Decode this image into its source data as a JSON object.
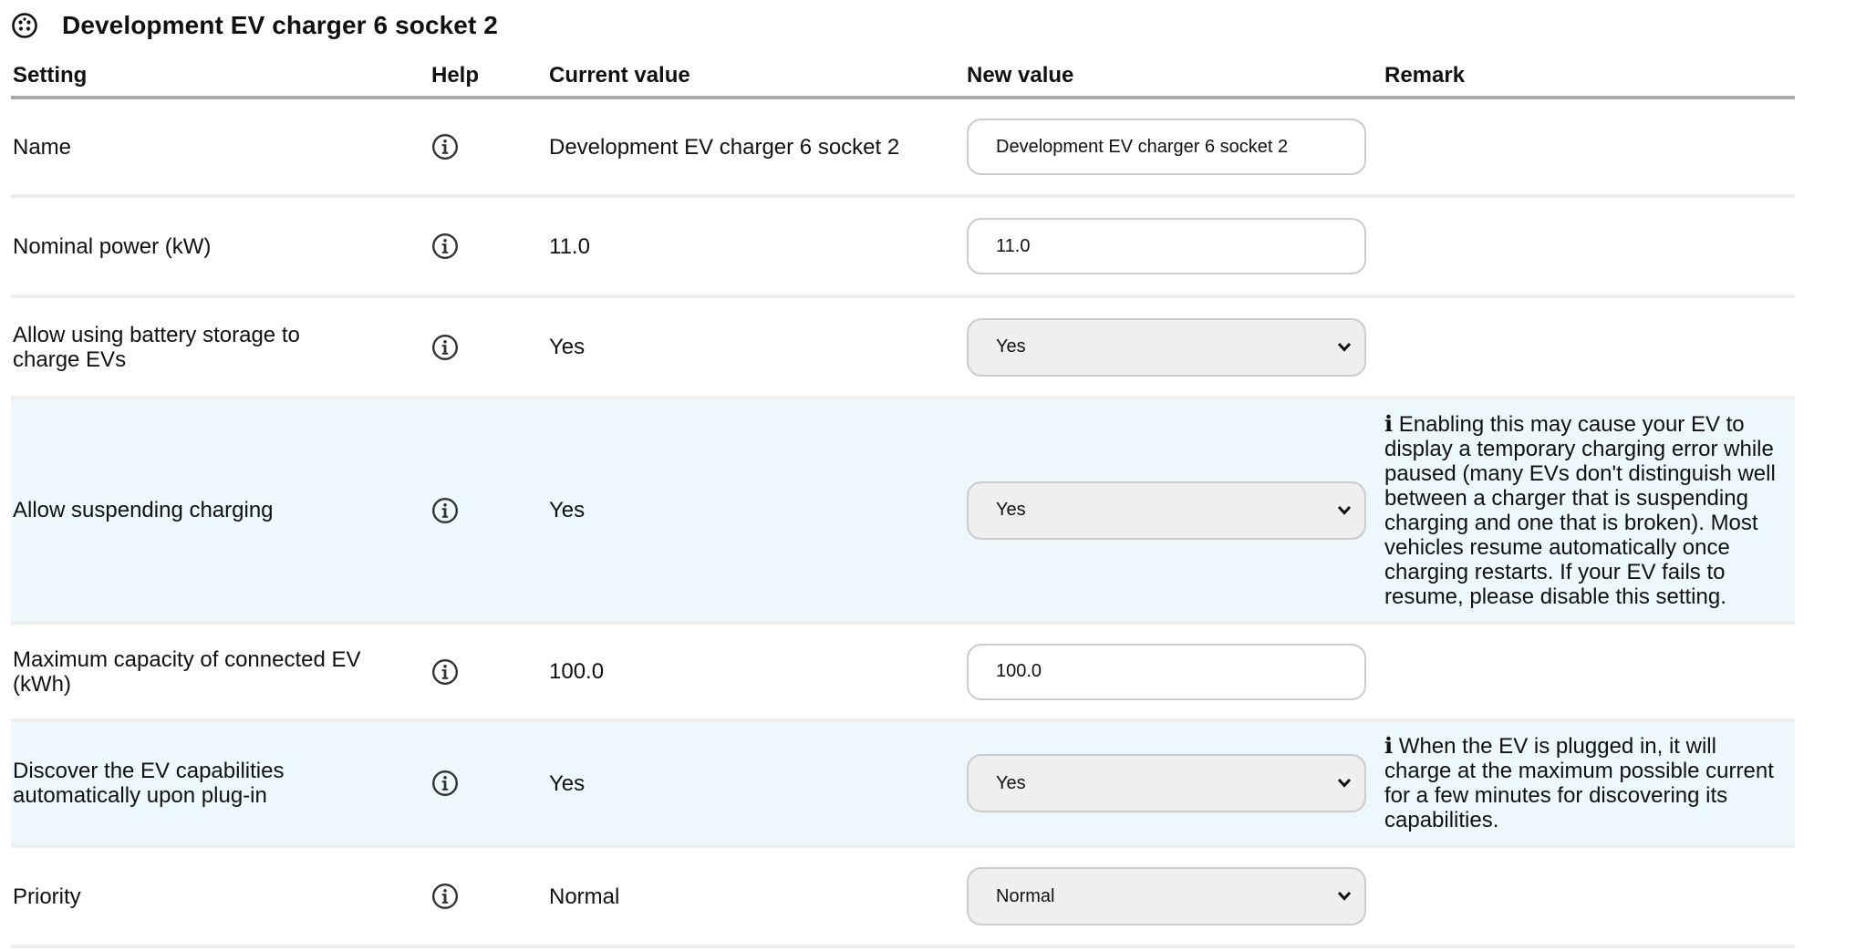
{
  "page": {
    "title": "Development EV charger 6 socket 2",
    "title_icon": "ev-plug-socket-icon"
  },
  "table": {
    "headers": {
      "setting": "Setting",
      "help": "Help",
      "current": "Current value",
      "new": "New value",
      "remark": "Remark"
    },
    "rows": [
      {
        "setting": "Name",
        "current": "Development EV charger 6 socket 2",
        "new_type": "text",
        "new_value": "Development EV charger 6 socket 2",
        "remark": ""
      },
      {
        "setting": "Nominal power (kW)",
        "current": "11.0",
        "new_type": "text",
        "new_value": "11.0",
        "remark": ""
      },
      {
        "setting": "Allow using battery storage to charge EVs",
        "current": "Yes",
        "new_type": "select",
        "new_value": "Yes",
        "remark": ""
      },
      {
        "setting": "Allow suspending charging",
        "current": "Yes",
        "new_type": "select",
        "new_value": "Yes",
        "remark": "ℹ Enabling this may cause your EV to display a temporary charging error while paused (many EVs don't distinguish well between a charger that is suspending charging and one that is broken). Most vehicles resume automatically once charging restarts. If your EV fails to resume, please disable this setting."
      },
      {
        "setting": "Maximum capacity of connected EV (kWh)",
        "current": "100.0",
        "new_type": "text",
        "new_value": "100.0",
        "remark": ""
      },
      {
        "setting": "Discover the EV capabilities automatically upon plug-in",
        "current": "Yes",
        "new_type": "select",
        "new_value": "Yes",
        "remark": "ℹ When the EV is plugged in, it will charge at the maximum possible current for a few minutes for discovering its capabilities."
      },
      {
        "setting": "Priority",
        "current": "Normal",
        "new_type": "select",
        "new_value": "Normal",
        "remark": ""
      }
    ]
  },
  "colors": {
    "header_rule": "#aaaaaa",
    "row_rule": "#eeeeee",
    "remark_row_bg": "#ecf8fc",
    "select_bg": "#efefef",
    "field_border": "#cccccc"
  },
  "icons": {
    "help": "info-circle-icon",
    "dropdown": "chevron-down-icon"
  }
}
